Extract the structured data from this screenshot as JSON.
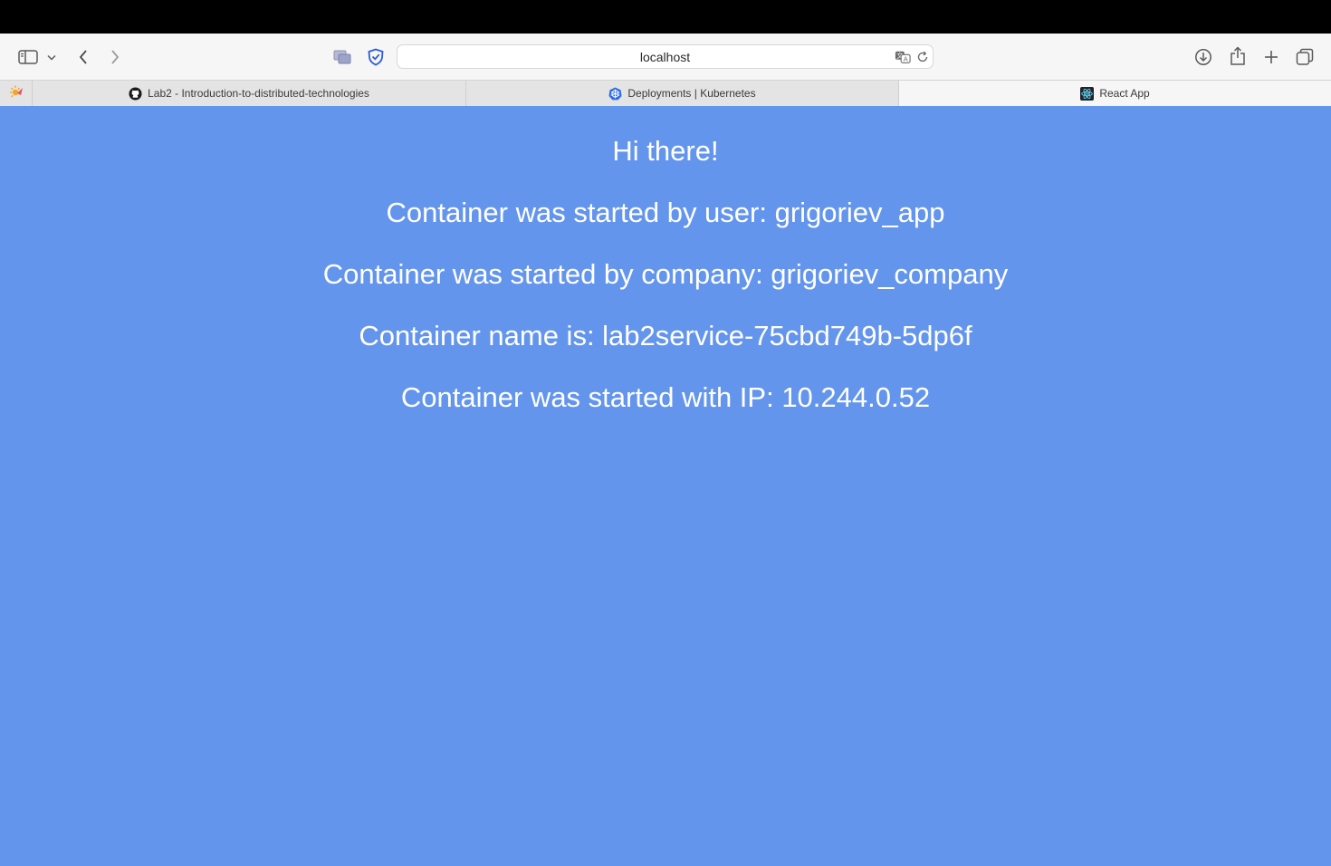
{
  "browser": {
    "address": "localhost",
    "tabs": [
      {
        "label": "Lab2 - Introduction-to-distributed-technologies",
        "active": false
      },
      {
        "label": "Deployments | Kubernetes",
        "active": false
      },
      {
        "label": "React App",
        "active": true
      }
    ]
  },
  "page": {
    "background_color": "#6495ed",
    "greeting": "Hi there!",
    "user_line": "Container was started by user: grigoriev_app",
    "company_line": "Container was started by company: grigoriev_company",
    "name_line": "Container name is: lab2service-75cbd749b-5dp6f",
    "ip_line": "Container was started with IP: 10.244.0.52"
  }
}
